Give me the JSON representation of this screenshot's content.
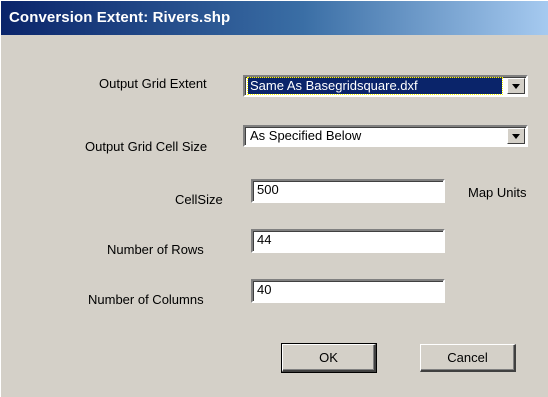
{
  "window": {
    "title": "Conversion Extent: Rivers.shp"
  },
  "form": {
    "extent_label": "Output Grid Extent",
    "extent_value": "Same As Basegridsquare.dxf",
    "cellsize_mode_label": "Output Grid Cell Size",
    "cellsize_mode_value": "As Specified Below",
    "cellsize_label": "CellSize",
    "cellsize_value": "500",
    "units_label": "Map Units",
    "rows_label": "Number of Rows",
    "rows_value": "44",
    "columns_label": "Number of Columns",
    "columns_value": "40"
  },
  "buttons": {
    "ok": "OK",
    "cancel": "Cancel"
  },
  "colors": {
    "title_gradient_start": "#0a246a",
    "title_gradient_end": "#a6caf0",
    "dialog_bg": "#d4d0c8",
    "selection_bg": "#0a246a"
  },
  "icons": {
    "dropdown": "chevron-down-icon"
  }
}
